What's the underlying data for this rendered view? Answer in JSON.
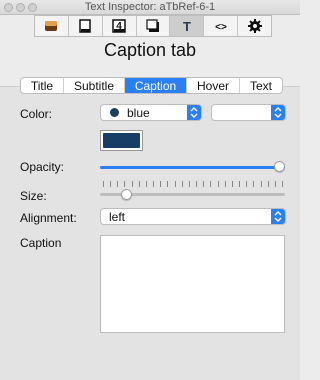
{
  "window": {
    "title": "Text Inspector: aTbRef-6-1"
  },
  "toolbar": {
    "buttons": [
      {
        "icon": "properties-icon"
      },
      {
        "icon": "document-icon"
      },
      {
        "icon": "number-icon",
        "text": "4"
      },
      {
        "icon": "shadow-icon"
      },
      {
        "icon": "text-icon",
        "text": "T",
        "active": true
      },
      {
        "icon": "code-icon",
        "text": "<>"
      },
      {
        "icon": "gear-icon"
      }
    ]
  },
  "heading": "Caption tab",
  "tabs": [
    {
      "label": "Title"
    },
    {
      "label": "Subtitle"
    },
    {
      "label": "Caption",
      "active": true
    },
    {
      "label": "Hover"
    },
    {
      "label": "Text"
    }
  ],
  "color": {
    "label": "Color:",
    "value": "blue",
    "secondary_value": "",
    "swatch_hex": "#173e66"
  },
  "opacity": {
    "label": "Opacity:",
    "level_percent": 100
  },
  "size": {
    "label": "Size:",
    "level_percent": 12
  },
  "alignment": {
    "label": "Alignment:",
    "value": "left"
  },
  "caption": {
    "label": "Caption",
    "value": ""
  },
  "accent_color": "#2a7ff5"
}
